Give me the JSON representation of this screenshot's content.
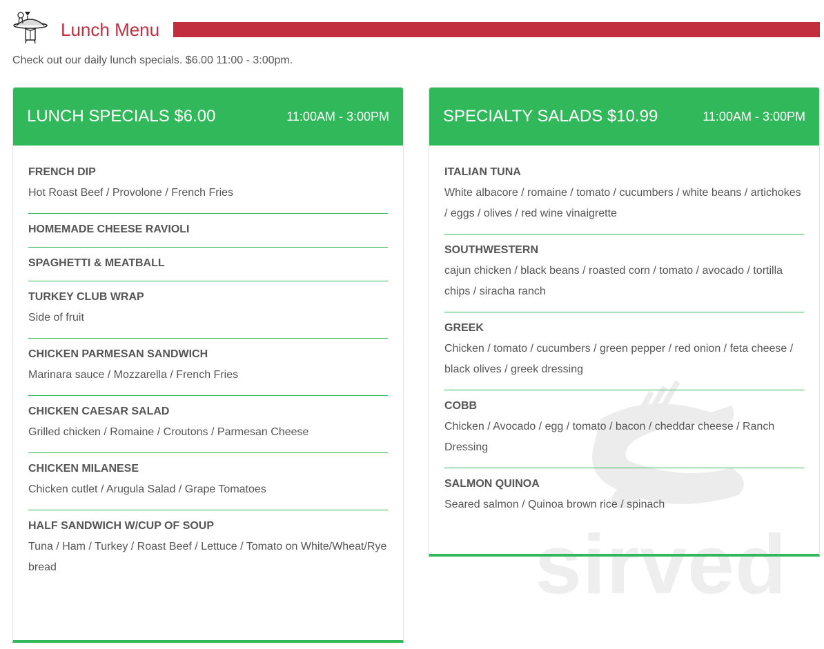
{
  "header": {
    "logo_icon": "waiter-serving-platter-icon",
    "title": "Lunch Menu",
    "intro": "Check out our daily lunch specials. $6.00 11:00 - 3:00pm.",
    "colors": {
      "title": "#c22e3e",
      "accent": "#30b85a"
    }
  },
  "watermark": {
    "text": "sirved",
    "icon": "fork-knife-icon"
  },
  "sections": [
    {
      "title": "LUNCH SPECIALS $6.00",
      "hours": "11:00AM - 3:00PM",
      "items": [
        {
          "name": "FRENCH DIP",
          "desc": "Hot Roast Beef / Provolone / French Fries"
        },
        {
          "name": "HOMEMADE CHEESE RAVIOLI",
          "desc": ""
        },
        {
          "name": "SPAGHETTI & MEATBALL",
          "desc": ""
        },
        {
          "name": "TURKEY CLUB WRAP",
          "desc": "Side of fruit"
        },
        {
          "name": "CHICKEN PARMESAN SANDWICH",
          "desc": "Marinara sauce / Mozzarella / French Fries"
        },
        {
          "name": "CHICKEN CAESAR SALAD",
          "desc": "Grilled chicken / Romaine / Croutons / Parmesan Cheese"
        },
        {
          "name": "CHICKEN MILANESE",
          "desc": "Chicken cutlet / Arugula Salad / Grape Tomatoes"
        },
        {
          "name": "HALF SANDWICH W/CUP OF SOUP",
          "desc": "Tuna / Ham / Turkey / Roast Beef / Lettuce / Tomato on White/Wheat/Rye bread"
        }
      ]
    },
    {
      "title": "SPECIALTY SALADS $10.99",
      "hours": "11:00AM - 3:00PM",
      "items": [
        {
          "name": "ITALIAN TUNA",
          "desc": "White albacore / romaine / tomato / cucumbers / white beans / artichokes / eggs / olives / red wine vinaigrette"
        },
        {
          "name": "SOUTHWESTERN",
          "desc": "cajun chicken / black beans / roasted corn / tomato / avocado / tortilla chips / siracha ranch"
        },
        {
          "name": "GREEK",
          "desc": "Chicken / tomato / cucumbers / green pepper / red onion / feta cheese / black olives / greek dressing"
        },
        {
          "name": "COBB",
          "desc": "Chicken / Avocado / egg / tomato / bacon / cheddar cheese / Ranch Dressing"
        },
        {
          "name": "SALMON QUINOA",
          "desc": "Seared salmon / Quinoa brown rice / spinach"
        }
      ]
    }
  ]
}
